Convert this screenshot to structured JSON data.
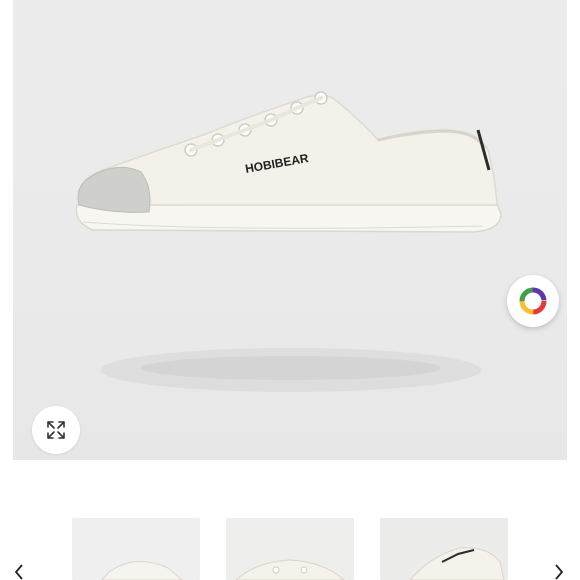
{
  "product": {
    "brand_text": "HOBIBEAR"
  },
  "viewer": {
    "expand_icon": "expand-arrows-icon",
    "ar_icon": "color-wheel-icon"
  },
  "thumbnails": {
    "items": [
      {
        "alt": "thumbnail-1"
      },
      {
        "alt": "thumbnail-2"
      },
      {
        "alt": "thumbnail-3"
      }
    ],
    "prev_icon": "chevron-left-icon",
    "next_icon": "chevron-right-icon"
  },
  "colors": {
    "background": "#ececec",
    "shoe": "#f3f1ea",
    "toe_cap": "#cfcfcc",
    "sole": "#f7f6f1"
  }
}
